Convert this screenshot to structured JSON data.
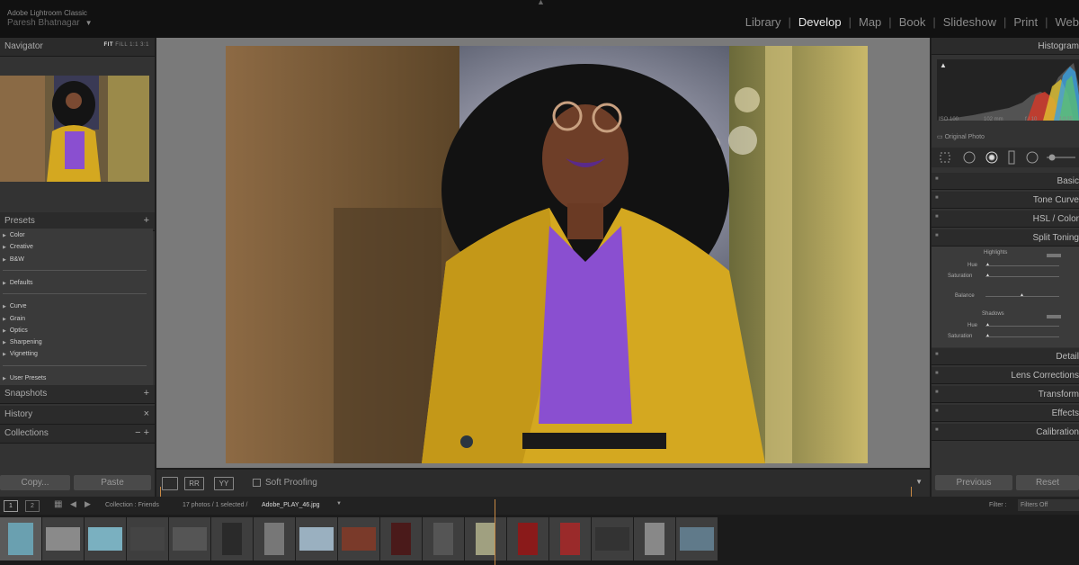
{
  "app": {
    "name": "Adobe Lightroom Classic",
    "user": "Paresh Bhatnagar"
  },
  "modules": [
    "Library",
    "Develop",
    "Map",
    "Book",
    "Slideshow",
    "Print",
    "Web"
  ],
  "active_module": "Develop",
  "left_panel": {
    "navigator": {
      "title": "Navigator",
      "zoom_options": [
        "FIT",
        "FILL",
        "1:1",
        "3:1"
      ]
    },
    "presets": {
      "title": "Presets",
      "groups": [
        [
          "Color",
          "Creative",
          "B&W"
        ],
        [
          "Defaults"
        ],
        [
          "Curve",
          "Grain",
          "Optics",
          "Sharpening",
          "Vignetting"
        ],
        [
          "User Presets"
        ]
      ]
    },
    "snapshots": "Snapshots",
    "history": "History",
    "collections": "Collections",
    "copy_label": "Copy...",
    "paste_label": "Paste"
  },
  "toolbar": {
    "view_buttons": [
      "RR",
      "YY"
    ],
    "soft_proofing": "Soft Proofing"
  },
  "right_panel": {
    "histogram": {
      "title": "Histogram",
      "iso": "ISO 100",
      "focal": "102 mm",
      "aperture": "f / 10",
      "shutter": "1/125",
      "original_photo": "Original Photo"
    },
    "sections": [
      "Basic",
      "Tone Curve",
      "HSL / Color",
      "Split Toning",
      "Detail",
      "Lens Corrections",
      "Transform",
      "Effects",
      "Calibration"
    ],
    "split_toning": {
      "highlights": "Highlights",
      "shadows": "Shadows",
      "hue": "Hue",
      "saturation": "Saturation",
      "balance": "Balance"
    },
    "previous_label": "Previous",
    "reset_label": "Reset"
  },
  "filmstrip_bar": {
    "collection": "Collection : Friends",
    "info": "17 photos / 1 selected /",
    "filename": "Adobe_PLAY_46.jpg",
    "filter_label": "Filter :",
    "filter_value": "Filters Off"
  },
  "filmstrip": {
    "count": 17,
    "selected_index": 0
  },
  "colors": {
    "accent_orange": "#c98a45",
    "coat_yellow": "#d4a820",
    "sweater_purple": "#8a4fd0"
  }
}
